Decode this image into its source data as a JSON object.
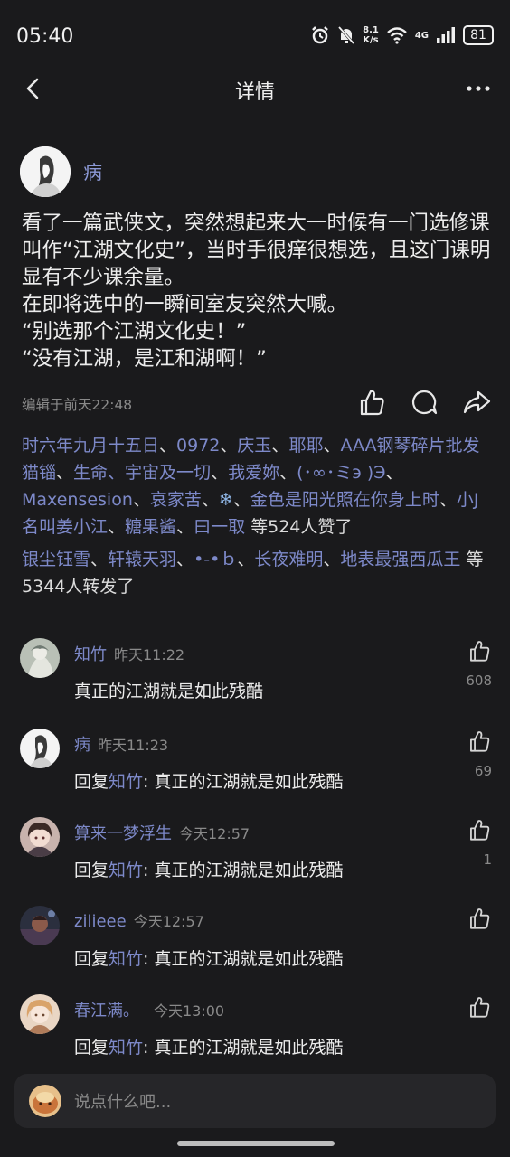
{
  "status_bar": {
    "time": "05:40",
    "net_speed_value": "8.1",
    "net_speed_unit": "K/s",
    "signal_label": "4G",
    "battery": "81",
    "icons": [
      "alarm-icon",
      "mute-icon",
      "wifi-icon",
      "signal-icon",
      "battery-icon"
    ]
  },
  "header": {
    "title": "详情",
    "icons": [
      "back-icon",
      "more-icon"
    ]
  },
  "post": {
    "author": "病",
    "body": [
      "看了一篇武侠文，突然想起来大一时候有一门选修课叫作“江湖文化史”，当时手很痒很想选，且这门课明显有不少课余量。",
      "在即将选中的一瞬间室友突然大喊。",
      "“别选那个江湖文化史！”",
      "“没有江湖，是江和湖啊！”"
    ],
    "edited": "编辑于前天22:48",
    "action_icons": [
      "like-icon",
      "comment-icon",
      "share-icon"
    ]
  },
  "likes": {
    "names": [
      "时六年九月十五日",
      "0972",
      "庆玉",
      "耶耶",
      "AAA钢琴碎片批发猫锱",
      "生命、宇宙及一切",
      "我爱妳",
      "(･∞･ミэ )Э",
      "Maxensesion",
      "哀家苦",
      "❄",
      "金色是阳光照在你身上时",
      "小J名叫姜小江",
      "糖果酱",
      "曰一取"
    ],
    "summary": "等524人赞了"
  },
  "reposts": {
    "names": [
      "银尘钰雪",
      "轩辕天羽",
      "•-•ｂ",
      "长夜难明",
      "地表最强西瓜王"
    ],
    "summary": "等5344人转发了"
  },
  "comments": [
    {
      "name": "知竹",
      "time": "昨天11:22",
      "reply_prefix": "",
      "reply_to": "",
      "text": "真正的江湖就是如此残酷",
      "likes": "608"
    },
    {
      "name": "病",
      "time": "昨天11:23",
      "reply_prefix": "回复",
      "reply_to": "知竹",
      "text": ": 真正的江湖就是如此残酷",
      "likes": "69"
    },
    {
      "name": "算来一梦浮生",
      "time": "今天12:57",
      "reply_prefix": "回复",
      "reply_to": "知竹",
      "text": ": 真正的江湖就是如此残酷",
      "likes": "1"
    },
    {
      "name": "zilieee",
      "time": "今天12:57",
      "reply_prefix": "回复",
      "reply_to": "知竹",
      "text": ": 真正的江湖就是如此残酷",
      "likes": ""
    },
    {
      "name": "春江满。",
      "time": "今天13:00",
      "reply_prefix": "回复",
      "reply_to": "知竹",
      "text": ": 真正的江湖就是如此残酷",
      "likes": ""
    }
  ],
  "input": {
    "placeholder": "说点什么吧..."
  },
  "colors": {
    "background": "#1a1a1c",
    "link": "#7d89c9",
    "text": "#ececec",
    "muted": "#8a8a8a"
  }
}
